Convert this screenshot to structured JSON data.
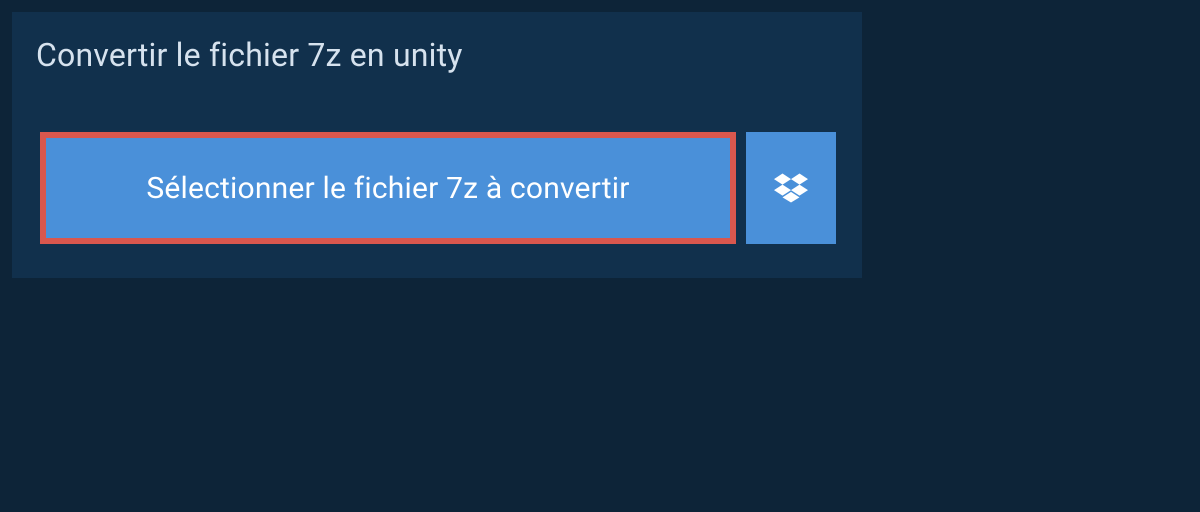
{
  "header": {
    "title": "Convertir le fichier 7z en unity"
  },
  "actions": {
    "select_file_label": "Sélectionner le fichier 7z à convertir"
  }
}
